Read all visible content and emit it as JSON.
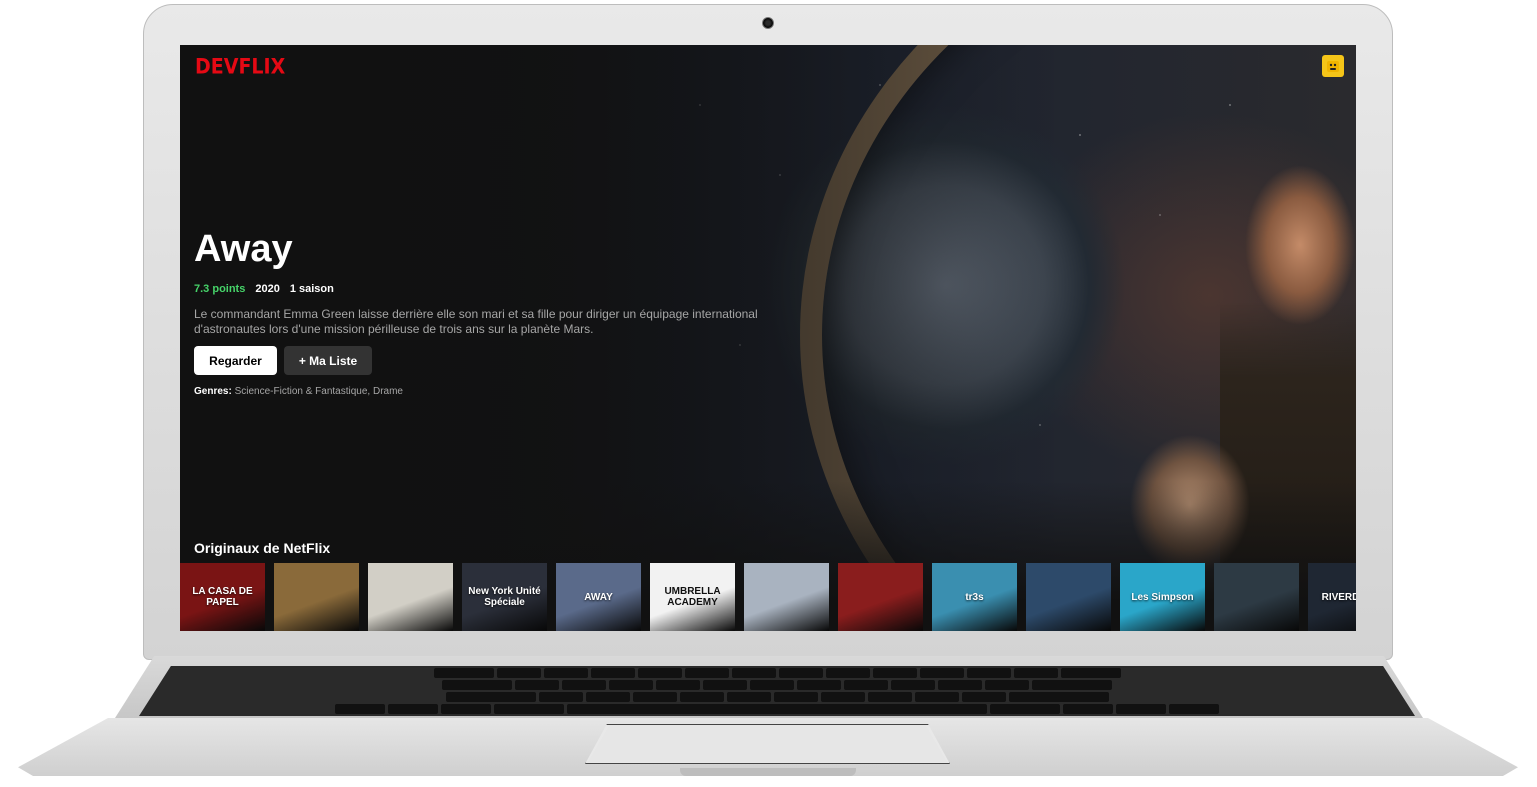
{
  "app": {
    "logo": "DEVFLIX",
    "avatar_icon": "user-avatar-icon"
  },
  "hero": {
    "title": "Away",
    "points": "7.3 points",
    "year": "2020",
    "seasons": "1 saison",
    "description": "Le commandant Emma Green laisse derrière elle son mari et sa fille pour diriger un équipage international d'astronautes lors d'une mission périlleuse de trois ans sur la planète Mars.",
    "play_label": "Regarder",
    "list_label": "+ Ma Liste",
    "genres_label": "Genres:",
    "genres_value": "Science-Fiction & Fantastique, Drame"
  },
  "row": {
    "title": "Originaux de NetFlix",
    "items": [
      {
        "label": "LA CASA DE PAPEL",
        "color": "#7a1414"
      },
      {
        "label": "",
        "color": "#8a6a3a"
      },
      {
        "label": "",
        "color": "#d2cfc6"
      },
      {
        "label": "New York Unité Spéciale",
        "color": "#2b2f3a"
      },
      {
        "label": "AWAY",
        "color": "#5a6a8a"
      },
      {
        "label": "UMBRELLA ACADEMY",
        "color": "#f2f2f2"
      },
      {
        "label": "",
        "color": "#a9b3c0"
      },
      {
        "label": "",
        "color": "#8a1d1d"
      },
      {
        "label": "tr3s",
        "color": "#3a8fb0"
      },
      {
        "label": "",
        "color": "#2d4a6a"
      },
      {
        "label": "Les Simpson",
        "color": "#2aa6c9"
      },
      {
        "label": "",
        "color": "#2d3a44"
      },
      {
        "label": "RIVERDALE",
        "color": "#1f2733"
      }
    ]
  }
}
